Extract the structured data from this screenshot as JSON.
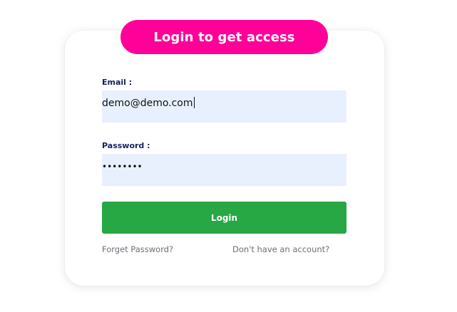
{
  "colors": {
    "banner_bg": "#ff0099",
    "input_bg": "#e8f0fe",
    "button_bg": "#28a745",
    "label_color": "#15225a",
    "link_color": "#6e6e7a"
  },
  "banner": {
    "title": "Login to get access"
  },
  "form": {
    "email_label": "Email :",
    "email_value": "demo@demo.com",
    "password_label": "Password :",
    "password_display": "••••••••",
    "login_label": "Login"
  },
  "links": {
    "forgot_password": "Forget Password?",
    "signup": "Don't have an account?"
  }
}
